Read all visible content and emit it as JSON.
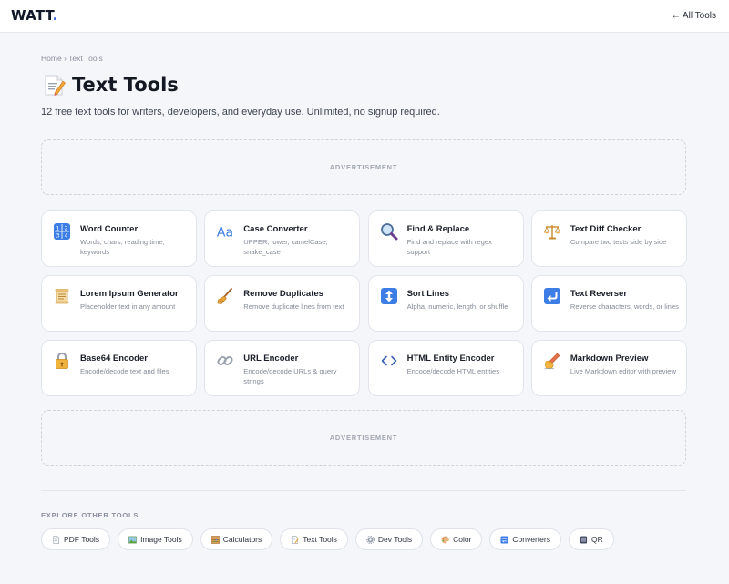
{
  "header": {
    "logo_text": "WATT",
    "logo_dot": ".",
    "all_tools": "← All Tools"
  },
  "breadcrumb": {
    "home": "Home",
    "sep": "›",
    "current": "Text Tools"
  },
  "page": {
    "title_icon": "memo-icon",
    "title": "Text Tools",
    "subtitle": "12 free text tools for writers, developers, and everyday use. Unlimited, no signup required."
  },
  "ads": {
    "label": "ADVERTISEMENT"
  },
  "tools": [
    {
      "icon": "number-keys-icon",
      "title": "Word Counter",
      "desc": "Words, chars, reading time, keywords"
    },
    {
      "icon": "letters-aa-icon",
      "title": "Case Converter",
      "desc": "UPPER, lower, camelCase, snake_case"
    },
    {
      "icon": "magnifier-icon",
      "title": "Find & Replace",
      "desc": "Find and replace with regex support"
    },
    {
      "icon": "scales-icon",
      "title": "Text Diff Checker",
      "desc": "Compare two texts side by side"
    },
    {
      "icon": "scroll-icon",
      "title": "Lorem Ipsum Generator",
      "desc": "Placeholder text in any amount"
    },
    {
      "icon": "broom-icon",
      "title": "Remove Duplicates",
      "desc": "Remove duplicate lines from text"
    },
    {
      "icon": "up-down-arrow-icon",
      "title": "Sort Lines",
      "desc": "Alpha, numeric, length, or shuffle"
    },
    {
      "icon": "return-arrow-icon",
      "title": "Text Reverser",
      "desc": "Reverse characters, words, or lines"
    },
    {
      "icon": "lock-icon",
      "title": "Base64 Encoder",
      "desc": "Encode/decode text and files"
    },
    {
      "icon": "link-icon",
      "title": "URL Encoder",
      "desc": "Encode/decode URLs & query strings"
    },
    {
      "icon": "code-brackets-icon",
      "title": "HTML Entity Encoder",
      "desc": "Encode/decode HTML entities"
    },
    {
      "icon": "writing-hand-icon",
      "title": "Markdown Preview",
      "desc": "Live Markdown editor with preview"
    }
  ],
  "explore": {
    "label": "EXPLORE OTHER TOOLS",
    "links": [
      {
        "icon": "document-icon",
        "label": "PDF Tools"
      },
      {
        "icon": "picture-icon",
        "label": "Image Tools"
      },
      {
        "icon": "abacus-icon",
        "label": "Calculators"
      },
      {
        "icon": "memo-icon",
        "label": "Text Tools"
      },
      {
        "icon": "gear-icon",
        "label": "Dev Tools"
      },
      {
        "icon": "palette-icon",
        "label": "Color"
      },
      {
        "icon": "swap-icon",
        "label": "Converters"
      },
      {
        "icon": "qr-code-icon",
        "label": "QR"
      }
    ]
  },
  "colors": {
    "accent": "#3b63e0",
    "page_bg": "#f5f6f9",
    "card_border": "#e2e5ec"
  }
}
